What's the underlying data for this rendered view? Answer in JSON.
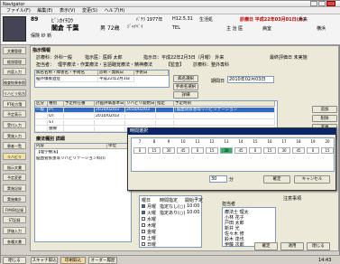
{
  "window": {
    "title": "Navigator"
  },
  "menu": [
    "ファイル(F)",
    "編集(E)",
    "表示(V)",
    "変更(S)",
    "ヘルプ(H)"
  ],
  "header": {
    "patient_id": "89",
    "patient_name_kana": "ﾋﾞﾝｶｲﾁﾛｳ",
    "patient_name": "閣倉 千葉",
    "gender_age": "男  72歳",
    "insurance": "ｼﾞｬｲﾍﾞｲ",
    "ward": "保険  紗 新",
    "meta1": "ﾊﾞﾁﾗ 1977年",
    "meta2": "H12.5.31",
    "meta3": "TEL",
    "meta4": "生活処",
    "date": "診療日 平成22年03月01日(木)",
    "doctor": "主 治 医",
    "date_label": "医師",
    "room": "病室",
    "status1": "外来",
    "status2": "横浜",
    "flag": "PJ"
  },
  "sidebar": {
    "items": [
      "文書管理",
      "経過管理",
      "内容入力",
      "検査結果参照",
      "リハビリ処方",
      "PT処方箋",
      "予定表示",
      "受付入力",
      "実施入力",
      "患者一覧",
      "リハビリ",
      "指示文書",
      "予定変更",
      "実施記録",
      "実施集計",
      "FIM/BI記録",
      "ST記録",
      "評価入力",
      "各種文書"
    ],
    "active_index": 10
  },
  "content": {
    "section_label": "指示情報",
    "order_fields": [
      "診療科：外科一般",
      "指示医：医師  太郎",
      "指示日：平成22年2月3日（月曜）  外来",
      "最終評価日  未実施"
    ],
    "fields2": [
      "担当者：",
      "理学療法・作業療法・言語聴覚療法・精神療法",
      "【監査】",
      "診療科：整外専科",
      "最終評価日"
    ],
    "disease_header": [
      "病名名称・障害名・手術名",
      "診断・発病日",
      "手術日"
    ],
    "disease_row": [
      "脳外傷後遺症",
      "平成22年2月3日"
    ],
    "buttons": {
      "select": "病名選択",
      "select2": "手術名選択",
      "detail": "詳細",
      "add": "追加",
      "delete": "削除",
      "change": "変更",
      "history": "前回読込"
    },
    "period_label": "期間日",
    "period_value": "2010年02月03日",
    "order_table": {
      "headers": [
        "区分",
        "種別",
        "予定所在番",
        "計画評価基準日",
        "リハビリ開始日",
        "指定",
        "予定時刻"
      ],
      "rows": [
        [
          "一般",
          "PT",
          "",
          "2010/02/03",
          "2010/02/03",
          "",
          "[脳血管疾患等リハビリテーション"
        ],
        [
          "",
          "OT",
          "",
          "2010/02/03",
          "",
          "",
          ""
        ],
        [
          "",
          "ST",
          "",
          "",
          "",
          "",
          ""
        ],
        [
          "",
          "独療",
          "",
          "",
          "",
          "",
          ""
        ]
      ]
    },
    "rehab_section": "療法種別 詳細",
    "sub_headers": [
      "内容",
      "単位"
    ],
    "content_lines": [
      "【理学療法】",
      "脳血管疾患等リハビリテーション料(Ⅰ)"
    ],
    "weekdays": [
      "月曜",
      "火曜",
      "水曜",
      "木曜",
      "金曜",
      "土曜",
      "日曜"
    ],
    "weekday_checks": [
      true,
      true,
      false,
      false,
      false,
      false,
      false
    ],
    "time_header": [
      "曜日",
      "時間指定",
      "開始予定"
    ],
    "time_rows": [
      [
        "指定なし(○)",
        "10:00"
      ],
      [
        "指定あり(○)",
        "10:00"
      ]
    ],
    "staff_label": "担当者",
    "staff_list": [
      "療法士  理太",
      "小林  花子",
      "戸田  太郎",
      "新井  光",
      "佐々木  修",
      "鈴木  達也",
      "伊藤  次郎"
    ],
    "footer_buttons": {
      "confirm": "確定",
      "apply": "適用",
      "close": "閉じる"
    },
    "notes_label": "注意事項"
  },
  "popup": {
    "title": "時間選択",
    "hours": [
      "7",
      "8",
      "9",
      "10",
      "11",
      "12",
      "13",
      "14",
      "15",
      "16",
      "17",
      "18",
      "19",
      "20"
    ],
    "slots": [
      "0",
      "15",
      "30",
      "45",
      "0",
      "15",
      "30",
      "45",
      "0",
      "15",
      "30",
      "45",
      "0",
      "15"
    ],
    "active_slot": 6,
    "minutes_value": "30",
    "unit": "分",
    "ok": "確定",
    "cancel": "キャンセル"
  },
  "statusbar": {
    "close": "閉じる",
    "scan": "スキャナ取込",
    "print": "印刷取込",
    "order": "オーダー履歴",
    "time": "14:43"
  }
}
